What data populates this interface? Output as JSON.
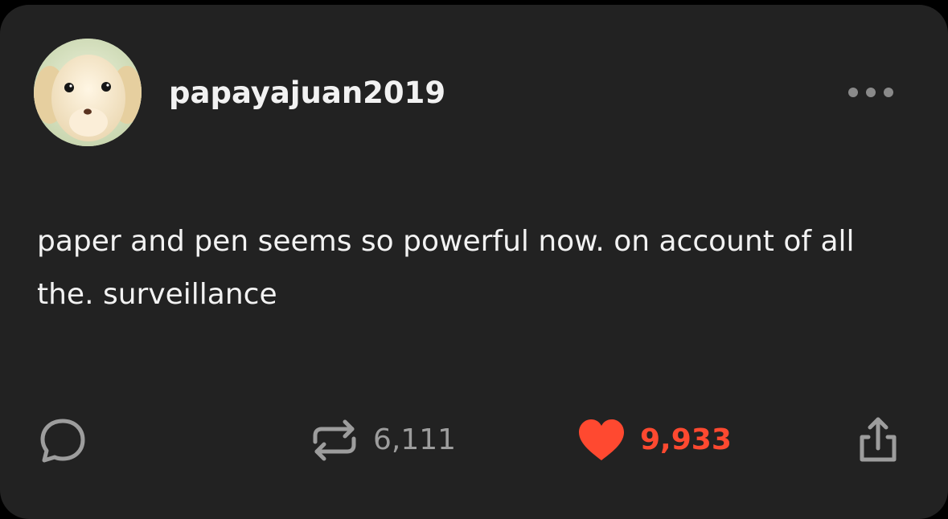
{
  "post": {
    "username": "papayajuan2019",
    "text": "paper and pen seems so powerful now. on account of all the. surveillance"
  },
  "actions": {
    "comment_icon": "speech-bubble-icon",
    "reblog_icon": "reblog-arrows-icon",
    "reblog_count": "6,111",
    "like_icon": "heart-icon",
    "like_count": "9,933",
    "share_icon": "share-upload-icon",
    "more_icon": "more-dots-icon"
  },
  "colors": {
    "background": "#222222",
    "text": "#f2f2f2",
    "muted": "#9d9d9d",
    "like": "#ff4930"
  }
}
